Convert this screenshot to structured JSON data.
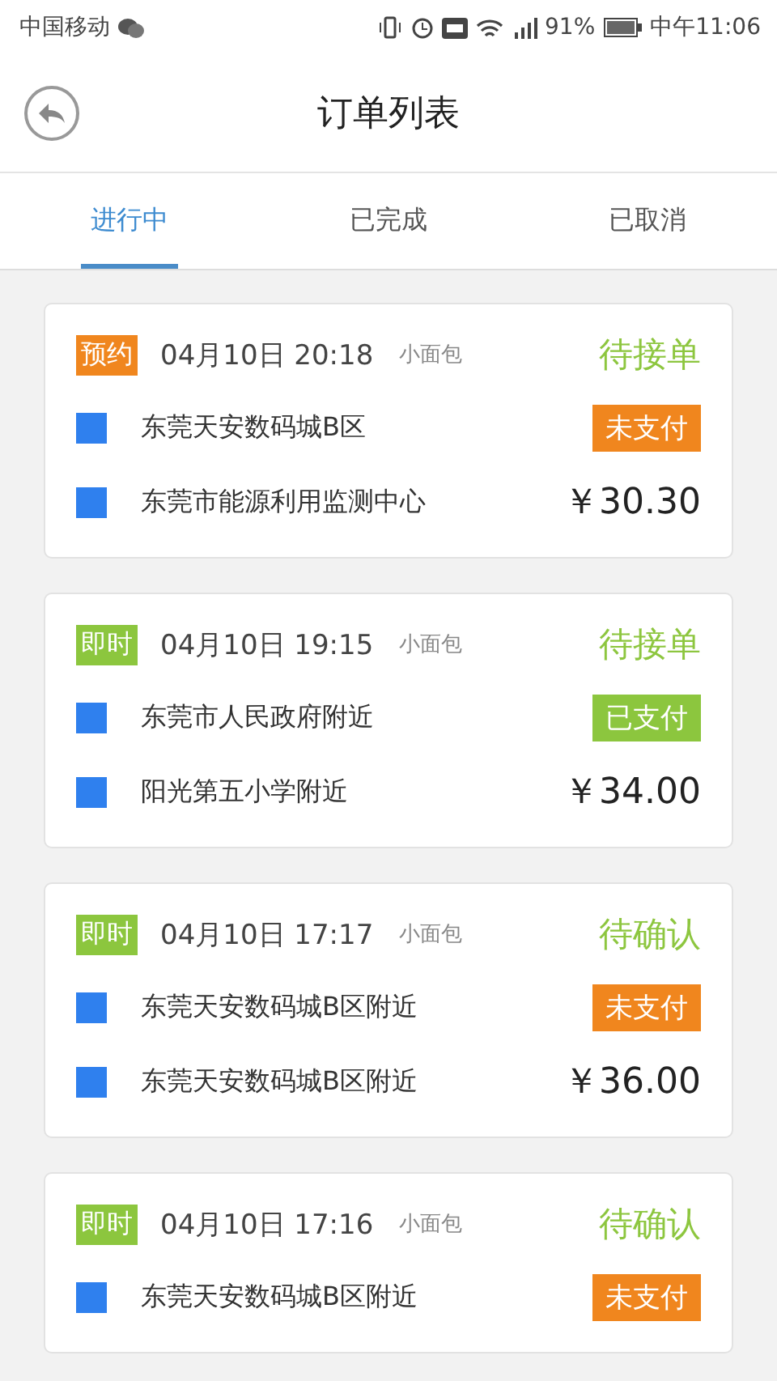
{
  "status_bar": {
    "carrier": "中国移动",
    "battery": "91%",
    "time": "中午11:06"
  },
  "header": {
    "title": "订单列表"
  },
  "tabs": [
    {
      "label": "进行中",
      "selected": true
    },
    {
      "label": "已完成",
      "selected": false
    },
    {
      "label": "已取消",
      "selected": false
    }
  ],
  "orders": [
    {
      "tag": {
        "label": "预约",
        "kind": "reserved"
      },
      "datetime": "04月10日 20:18",
      "vehicle": "小面包",
      "status": "待接单",
      "payment": {
        "label": "未支付",
        "kind": "unpaid"
      },
      "stops": [
        "东莞天安数码城B区",
        "东莞市能源利用监测中心"
      ],
      "price": "￥30.30"
    },
    {
      "tag": {
        "label": "即时",
        "kind": "instant"
      },
      "datetime": "04月10日 19:15",
      "vehicle": "小面包",
      "status": "待接单",
      "payment": {
        "label": "已支付",
        "kind": "paid"
      },
      "stops": [
        "东莞市人民政府附近",
        "阳光第五小学附近"
      ],
      "price": "￥34.00"
    },
    {
      "tag": {
        "label": "即时",
        "kind": "instant"
      },
      "datetime": "04月10日 17:17",
      "vehicle": "小面包",
      "status": "待确认",
      "payment": {
        "label": "未支付",
        "kind": "unpaid"
      },
      "stops": [
        "东莞天安数码城B区附近",
        "东莞天安数码城B区附近"
      ],
      "price": "￥36.00"
    },
    {
      "tag": {
        "label": "即时",
        "kind": "instant"
      },
      "datetime": "04月10日 17:16",
      "vehicle": "小面包",
      "status": "待确认",
      "payment": {
        "label": "未支付",
        "kind": "unpaid"
      },
      "stops": [
        "东莞天安数码城B区附近"
      ]
    }
  ]
}
